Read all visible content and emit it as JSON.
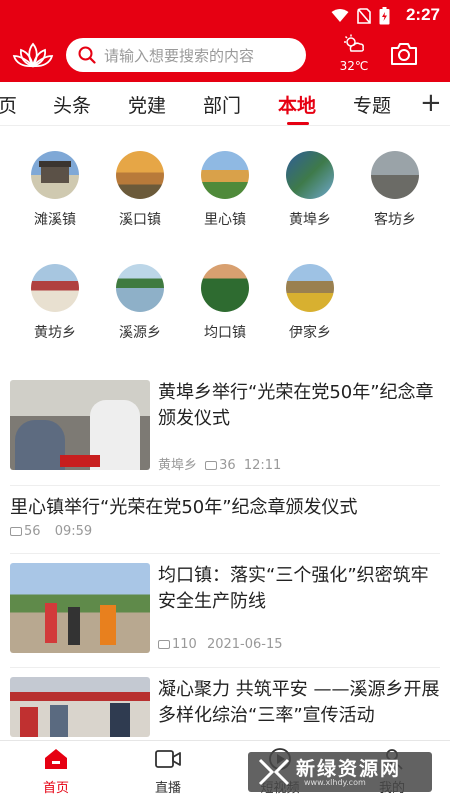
{
  "status": {
    "time": "2:27"
  },
  "header": {
    "search_placeholder": "请输入想要搜索的内容",
    "temperature": "32℃",
    "brand_color": "#e60012"
  },
  "tabs": [
    {
      "label": "页"
    },
    {
      "label": "头条"
    },
    {
      "label": "党建"
    },
    {
      "label": "部门"
    },
    {
      "label": "本地",
      "active": true
    },
    {
      "label": "专题"
    }
  ],
  "towns": [
    {
      "name": "滩溪镇"
    },
    {
      "name": "溪口镇"
    },
    {
      "name": "里心镇"
    },
    {
      "name": "黄埠乡"
    },
    {
      "name": "客坊乡"
    },
    {
      "name": "黄坊乡"
    },
    {
      "name": "溪源乡"
    },
    {
      "name": "均口镇"
    },
    {
      "name": "伊家乡"
    }
  ],
  "news": [
    {
      "title": "黄埠乡举行“光荣在党50年”纪念章颁发仪式",
      "source": "黄埠乡",
      "comments": "36",
      "time": "12:11"
    },
    {
      "title": "里心镇举行“光荣在党50年”纪念章颁发仪式",
      "comments": "56",
      "time": "09:59"
    },
    {
      "title": "均口镇：落实“三个强化”织密筑牢安全生产防线",
      "comments": "110",
      "time": "2021-06-15"
    },
    {
      "title": "凝心聚力 共筑平安 ——溪源乡开展多样化综治“三率”宣传活动"
    }
  ],
  "bottom_nav": [
    {
      "label": "首页",
      "icon": "home-icon",
      "active": true
    },
    {
      "label": "直播",
      "icon": "video-camera-icon"
    },
    {
      "label": "短视频",
      "icon": "short-video-icon"
    },
    {
      "label": "我的",
      "icon": "profile-icon"
    }
  ],
  "watermark": {
    "text": "新绿资源网",
    "sub": "www.xlhdy.com"
  }
}
